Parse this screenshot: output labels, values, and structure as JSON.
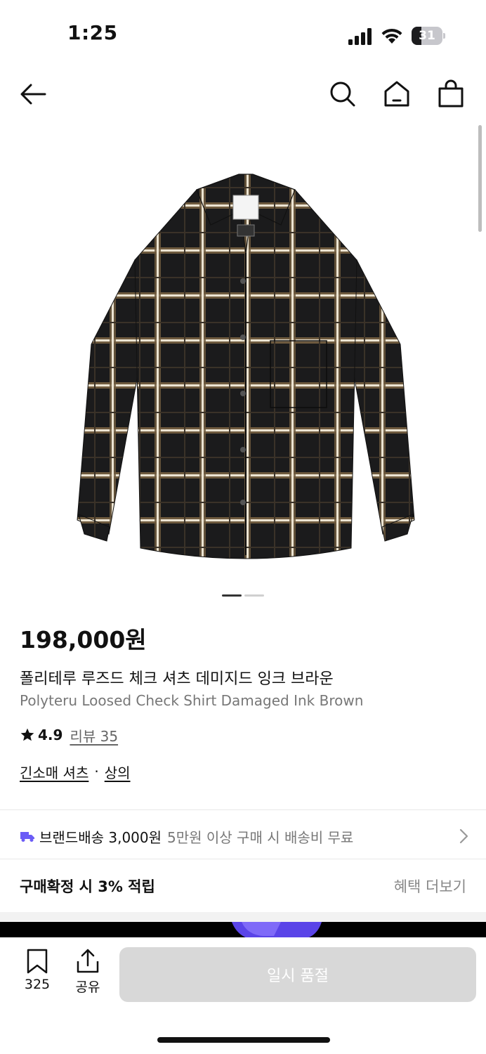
{
  "status": {
    "time": "1:25",
    "battery_level": "31",
    "battery_fraction": 0.31
  },
  "nav": {
    "icons": [
      "back-arrow-icon",
      "search-icon",
      "home-icon",
      "shopping-bag-icon"
    ]
  },
  "product": {
    "image": "plaid-check-shirt",
    "image_count": 2,
    "current_image": 1,
    "price": "198,000원",
    "title_ko": "폴리테루 루즈드 체크 셔츠 데미지드 잉크 브라운",
    "title_en": "Polyteru Loosed Check Shirt Damaged Ink Brown",
    "rating": "4.9",
    "review_label": "리뷰 35",
    "category_main": "긴소매 셔츠",
    "category_separator": "·",
    "category_sub": "상의"
  },
  "shipping": {
    "label": "브랜드배송 3,000원",
    "note": "5만원 이상 구매 시 배송비 무료",
    "icon": "truck-icon",
    "icon_color": "#6b5cf6"
  },
  "points": {
    "label": "구매확정 시 3% 적립",
    "benefits_link": "혜택 더보기"
  },
  "bottom_bar": {
    "bookmark_count": "325",
    "share_label": "공유",
    "soldout_label": "일시 품절"
  }
}
